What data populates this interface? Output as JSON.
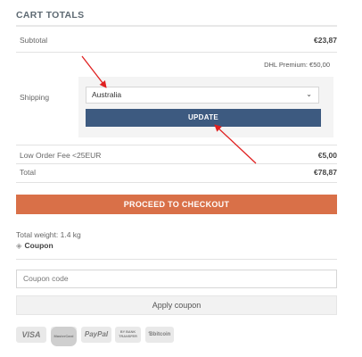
{
  "cart_totals": {
    "title": "CART TOTALS",
    "subtotal_label": "Subtotal",
    "subtotal_value": "€23,87",
    "shipping_label": "Shipping",
    "shipping_method": "DHL Premium: €50,00",
    "country_selected": "Australia",
    "update_label": "UPDATE",
    "fee_label": "Low Order Fee <25EUR",
    "fee_value": "€5,00",
    "total_label": "Total",
    "total_value": "€78,87"
  },
  "checkout_label": "PROCEED TO CHECKOUT",
  "weight_text": "Total weight: 1.4 kg",
  "coupon": {
    "toggle_label": "Coupon",
    "placeholder": "Coupon code",
    "apply_label": "Apply coupon"
  },
  "payment_logos": {
    "visa": "VISA",
    "mastercard": "MasterCard",
    "paypal": "PayPal",
    "bank_line1": "BY BANK",
    "bank_line2": "TRANSFER",
    "bitcoin": "Ɓbitcoin"
  },
  "colors": {
    "update_button": "#3d5a80",
    "checkout_button": "#d97048",
    "annotation_arrow": "#e02020"
  },
  "icons": {
    "coupon": "tag-icon",
    "select": "chevron-down-icon"
  }
}
